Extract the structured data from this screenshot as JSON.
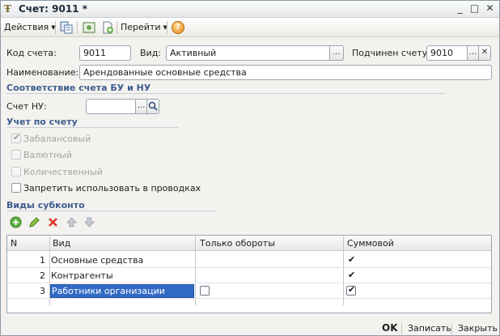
{
  "window": {
    "title": "Счет: 9011 *",
    "controls": {
      "minimize": "_",
      "maximize": "□",
      "close": "✕"
    }
  },
  "toolbar": {
    "actions_label": "Действия",
    "goto_label": "Перейти",
    "help_symbol": "?"
  },
  "form": {
    "code_label": "Код счета:",
    "code_value": "9011",
    "type_label": "Вид:",
    "type_value": "Активный",
    "parent_label": "Подчинен счету:",
    "parent_value": "9010",
    "name_label": "Наименование:",
    "name_value": "Арендованные основные средства",
    "ellipsis": "...",
    "clear_symbol": "✕"
  },
  "section_bu_nu": {
    "title": "Соответствие счета БУ и НУ",
    "nu_label": "Счет НУ:",
    "nu_value": ""
  },
  "section_accounting": {
    "title": "Учет по счету",
    "checkboxes": [
      {
        "label": "Забалансовый",
        "checked": true,
        "disabled": true
      },
      {
        "label": "Валютный",
        "checked": false,
        "disabled": true
      },
      {
        "label": "Количественный",
        "checked": false,
        "disabled": true
      },
      {
        "label": "Запретить использовать в проводках",
        "checked": false,
        "disabled": false
      }
    ]
  },
  "section_subconto": {
    "title": "Виды субконто",
    "columns": [
      "N",
      "Вид",
      "Только обороты",
      "Суммовой"
    ],
    "rows": [
      {
        "n": "1",
        "kind": "Основные средства",
        "turnover_only": false,
        "amount": true
      },
      {
        "n": "2",
        "kind": "Контрагенты",
        "turnover_only": false,
        "amount": true
      },
      {
        "n": "3",
        "kind": "Работники организации",
        "turnover_only": false,
        "amount": true
      }
    ],
    "check_mark": "✔"
  },
  "footer": {
    "ok_label": "OK",
    "save_label": "Записать",
    "close_label": "Закрыть"
  },
  "colors": {
    "section_title": "#3d5c8e",
    "selection": "#316ac5"
  }
}
